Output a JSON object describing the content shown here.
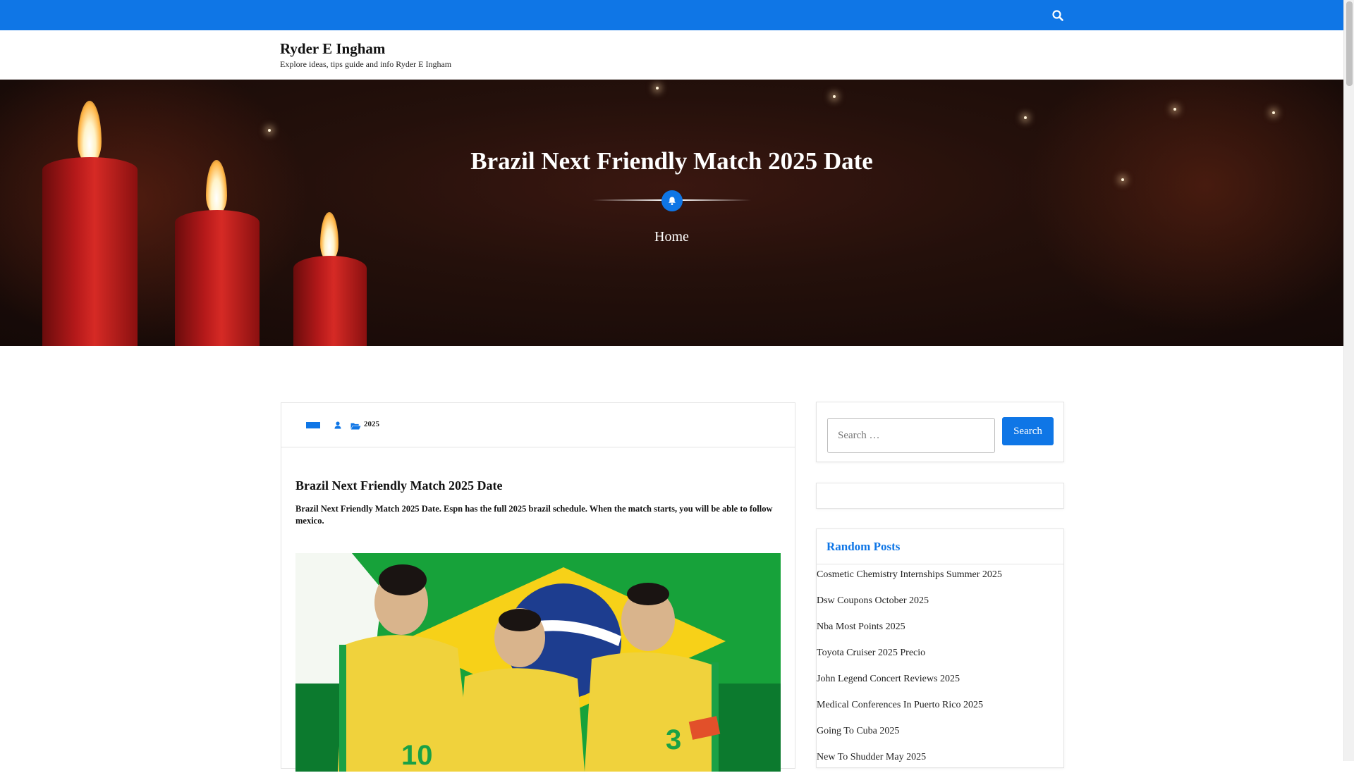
{
  "colors": {
    "accent": "#0f76e6",
    "text": "#222222",
    "hero_bg": "#24100b"
  },
  "header": {
    "site_title": "Ryder E Ingham",
    "site_description": "Explore ideas, tips guide and info Ryder E Ingham",
    "search_icon": "search-icon"
  },
  "hero": {
    "title": "Brazil Next Friendly Match 2025 Date",
    "badge_icon": "bell-icon",
    "breadcrumb": "Home"
  },
  "article": {
    "meta": {
      "date_icon": "calendar-icon",
      "author_icon": "user-icon",
      "category_icon": "folder-icon",
      "category": "2025"
    },
    "title": "Brazil Next Friendly Match 2025 Date",
    "excerpt": "Brazil Next Friendly Match 2025 Date. Espn has the full 2025 brazil schedule. When the match starts, you will be able to follow mexico.",
    "image_alt": "brazil-team-players-flag-image"
  },
  "sidebar": {
    "search": {
      "placeholder": "Search …",
      "button_label": "Search"
    },
    "random_posts": {
      "heading": "Random Posts",
      "items": [
        "Cosmetic Chemistry Internships Summer 2025",
        "Dsw Coupons October 2025",
        "Nba Most Points 2025",
        "Toyota Cruiser 2025 Precio",
        "John Legend Concert Reviews 2025",
        "Medical Conferences In Puerto Rico 2025",
        "Going To Cuba 2025",
        "New To Shudder May 2025"
      ]
    }
  }
}
